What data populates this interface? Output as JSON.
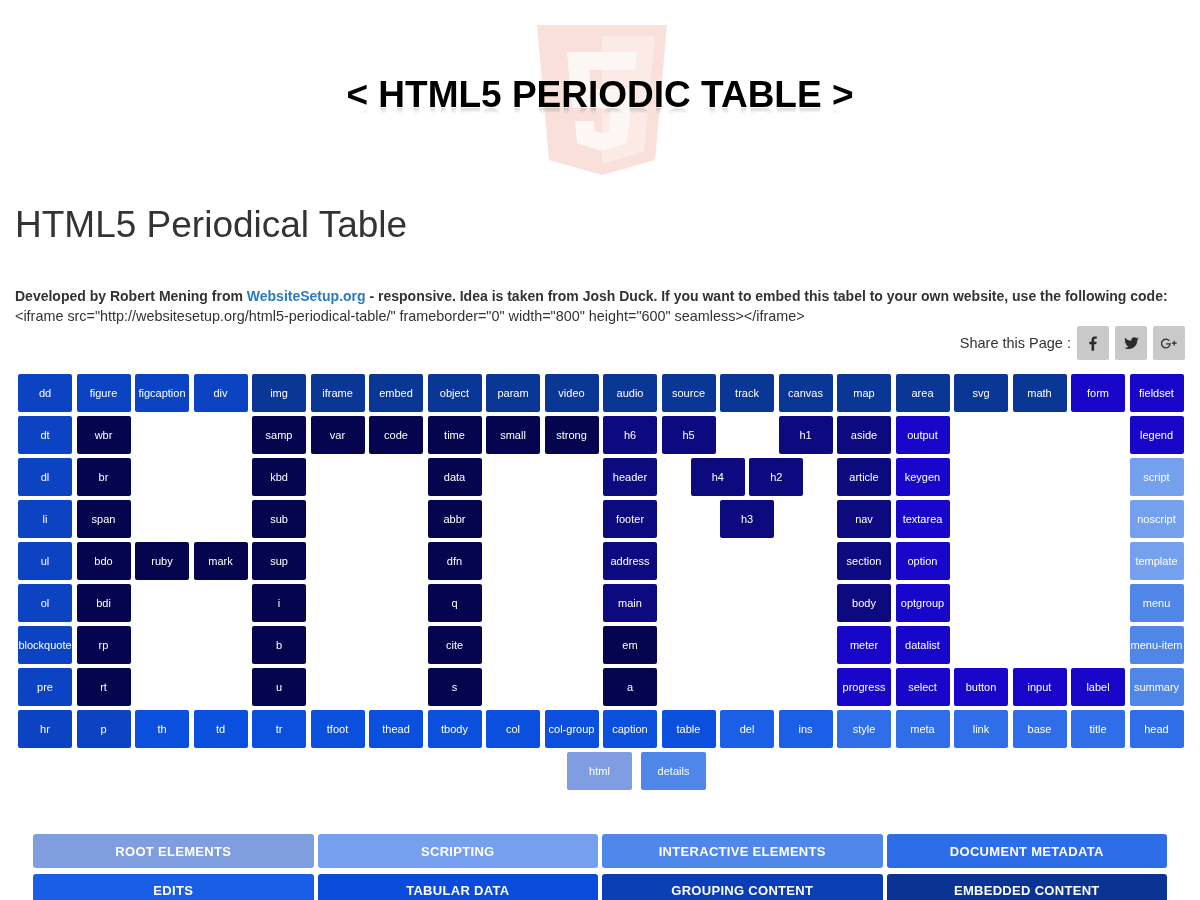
{
  "logo": {
    "text": "< HTML5 PERIODIC TABLE >"
  },
  "heading": "HTML5 Periodical Table",
  "intro": {
    "before": "Developed by Robert Mening from ",
    "link": "WebsiteSetup.org",
    "after": " - responsive. Idea is taken from Josh Duck. If you want to embed this tabel to your own website, use the following code:"
  },
  "embed_code": "<iframe src=\"http://websitesetup.org/html5-periodical-table/\" frameborder=\"0\" width=\"800\" height=\"600\" seamless></iframe>",
  "share": {
    "label": "Share this Page :",
    "buttons": [
      {
        "kind": "facebook"
      },
      {
        "kind": "twitter"
      },
      {
        "kind": "google_plus"
      }
    ]
  },
  "grid": {
    "rows": [
      [
        {
          "label": "dd",
          "color": "#0b43c2",
          "shifted": false
        },
        {
          "label": "figure",
          "color": "#0b43c2",
          "shifted": false
        },
        {
          "label": "figcaption",
          "color": "#0b43c2",
          "shifted": false
        },
        {
          "label": "div",
          "color": "#0b43c2",
          "shifted": false
        },
        {
          "label": "img",
          "color": "#0a3696",
          "shifted": false
        },
        {
          "label": "iframe",
          "color": "#0a3696",
          "shifted": false
        },
        {
          "label": "embed",
          "color": "#0a3696",
          "shifted": false
        },
        {
          "label": "object",
          "color": "#0a3696",
          "shifted": false
        },
        {
          "label": "param",
          "color": "#0a3696",
          "shifted": false
        },
        {
          "label": "video",
          "color": "#0a3696",
          "shifted": false
        },
        {
          "label": "audio",
          "color": "#0a3696",
          "shifted": false
        },
        {
          "label": "source",
          "color": "#0a3696",
          "shifted": false
        },
        {
          "label": "track",
          "color": "#0a3696",
          "shifted": false
        },
        {
          "label": "canvas",
          "color": "#0a3696",
          "shifted": false
        },
        {
          "label": "map",
          "color": "#0a3696",
          "shifted": false
        },
        {
          "label": "area",
          "color": "#0a3696",
          "shifted": false
        },
        {
          "label": "svg",
          "color": "#0a3696",
          "shifted": false
        },
        {
          "label": "math",
          "color": "#0a3696",
          "shifted": false
        },
        {
          "label": "form",
          "color": "#1706c9",
          "shifted": false
        },
        {
          "label": "fieldset",
          "color": "#1706c9",
          "shifted": false
        }
      ],
      [
        {
          "label": "dt",
          "color": "#0b43c2",
          "shifted": false
        },
        {
          "label": "wbr",
          "color": "#04044f",
          "shifted": false
        },
        null,
        null,
        {
          "label": "samp",
          "color": "#04044f",
          "shifted": false
        },
        {
          "label": "var",
          "color": "#04044f",
          "shifted": false
        },
        {
          "label": "code",
          "color": "#04044f",
          "shifted": false
        },
        {
          "label": "time",
          "color": "#04044f",
          "shifted": false
        },
        {
          "label": "small",
          "color": "#04044f",
          "shifted": false
        },
        {
          "label": "strong",
          "color": "#04044f",
          "shifted": false
        },
        {
          "label": "h6",
          "color": "#0d0a80",
          "shifted": false
        },
        {
          "label": "h5",
          "color": "#0d0a80",
          "shifted": false
        },
        null,
        {
          "label": "h1",
          "color": "#0d0a80",
          "shifted": false
        },
        {
          "label": "aside",
          "color": "#0d0a80",
          "shifted": false
        },
        {
          "label": "output",
          "color": "#1706c9",
          "shifted": false
        },
        null,
        null,
        null,
        {
          "label": "legend",
          "color": "#1706c9",
          "shifted": false
        }
      ],
      [
        {
          "label": "dl",
          "color": "#0b43c2",
          "shifted": false
        },
        {
          "label": "br",
          "color": "#04044f",
          "shifted": false
        },
        null,
        null,
        {
          "label": "kbd",
          "color": "#04044f",
          "shifted": false
        },
        null,
        null,
        {
          "label": "data",
          "color": "#04044f",
          "shifted": false
        },
        null,
        null,
        {
          "label": "header",
          "color": "#0d0a80",
          "shifted": false
        },
        null,
        {
          "label": "h4",
          "color": "#0d0a80",
          "shifted": true
        },
        {
          "label": "h2",
          "color": "#0d0a80",
          "shifted": true
        },
        {
          "label": "article",
          "color": "#0d0a80",
          "shifted": false
        },
        {
          "label": "keygen",
          "color": "#1706c9",
          "shifted": false
        },
        null,
        null,
        null,
        {
          "label": "script",
          "color": "#75a0ee",
          "shifted": false
        }
      ],
      [
        {
          "label": "li",
          "color": "#0b43c2",
          "shifted": false
        },
        {
          "label": "span",
          "color": "#04044f",
          "shifted": false
        },
        null,
        null,
        {
          "label": "sub",
          "color": "#04044f",
          "shifted": false
        },
        null,
        null,
        {
          "label": "abbr",
          "color": "#04044f",
          "shifted": false
        },
        null,
        null,
        {
          "label": "footer",
          "color": "#0d0a80",
          "shifted": false
        },
        null,
        {
          "label": "h3",
          "color": "#0d0a80",
          "shifted": false
        },
        null,
        {
          "label": "nav",
          "color": "#0d0a80",
          "shifted": false
        },
        {
          "label": "textarea",
          "color": "#1706c9",
          "shifted": false
        },
        null,
        null,
        null,
        {
          "label": "noscript",
          "color": "#75a0ee",
          "shifted": false
        }
      ],
      [
        {
          "label": "ul",
          "color": "#0b43c2",
          "shifted": false
        },
        {
          "label": "bdo",
          "color": "#04044f",
          "shifted": false
        },
        {
          "label": "ruby",
          "color": "#04044f",
          "shifted": false
        },
        {
          "label": "mark",
          "color": "#04044f",
          "shifted": false
        },
        {
          "label": "sup",
          "color": "#04044f",
          "shifted": false
        },
        null,
        null,
        {
          "label": "dfn",
          "color": "#04044f",
          "shifted": false
        },
        null,
        null,
        {
          "label": "address",
          "color": "#0d0a80",
          "shifted": false
        },
        null,
        null,
        null,
        {
          "label": "section",
          "color": "#0d0a80",
          "shifted": false
        },
        {
          "label": "option",
          "color": "#1706c9",
          "shifted": false
        },
        null,
        null,
        null,
        {
          "label": "template",
          "color": "#75a0ee",
          "shifted": false
        }
      ],
      [
        {
          "label": "ol",
          "color": "#0b43c2",
          "shifted": false
        },
        {
          "label": "bdi",
          "color": "#04044f",
          "shifted": false
        },
        null,
        null,
        {
          "label": "i",
          "color": "#04044f",
          "shifted": false
        },
        null,
        null,
        {
          "label": "q",
          "color": "#04044f",
          "shifted": false
        },
        null,
        null,
        {
          "label": "main",
          "color": "#0d0a80",
          "shifted": false
        },
        null,
        null,
        null,
        {
          "label": "body",
          "color": "#0d0a80",
          "shifted": false
        },
        {
          "label": "optgroup",
          "color": "#1706c9",
          "shifted": false
        },
        null,
        null,
        null,
        {
          "label": "menu",
          "color": "#4f86e8",
          "shifted": false
        }
      ],
      [
        {
          "label": "blockquote",
          "color": "#0b43c2",
          "shifted": false
        },
        {
          "label": "rp",
          "color": "#04044f",
          "shifted": false
        },
        null,
        null,
        {
          "label": "b",
          "color": "#04044f",
          "shifted": false
        },
        null,
        null,
        {
          "label": "cite",
          "color": "#04044f",
          "shifted": false
        },
        null,
        null,
        {
          "label": "em",
          "color": "#04044f",
          "shifted": false
        },
        null,
        null,
        null,
        {
          "label": "meter",
          "color": "#1706c9",
          "shifted": false
        },
        {
          "label": "datalist",
          "color": "#1706c9",
          "shifted": false
        },
        null,
        null,
        null,
        {
          "label": "menu-item",
          "color": "#4f86e8",
          "shifted": false
        }
      ],
      [
        {
          "label": "pre",
          "color": "#0b43c2",
          "shifted": false
        },
        {
          "label": "rt",
          "color": "#04044f",
          "shifted": false
        },
        null,
        null,
        {
          "label": "u",
          "color": "#04044f",
          "shifted": false
        },
        null,
        null,
        {
          "label": "s",
          "color": "#04044f",
          "shifted": false
        },
        null,
        null,
        {
          "label": "a",
          "color": "#04044f",
          "shifted": false
        },
        null,
        null,
        null,
        {
          "label": "progress",
          "color": "#1706c9",
          "shifted": false
        },
        {
          "label": "select",
          "color": "#1706c9",
          "shifted": false
        },
        {
          "label": "button",
          "color": "#1706c9",
          "shifted": false
        },
        {
          "label": "input",
          "color": "#1706c9",
          "shifted": false
        },
        {
          "label": "label",
          "color": "#1706c9",
          "shifted": false
        },
        {
          "label": "summary",
          "color": "#4f86e8",
          "shifted": false
        }
      ],
      [
        {
          "label": "hr",
          "color": "#0b43c2",
          "shifted": false
        },
        {
          "label": "p",
          "color": "#0b43c2",
          "shifted": false
        },
        {
          "label": "th",
          "color": "#0a4fde",
          "shifted": false
        },
        {
          "label": "td",
          "color": "#0a4fde",
          "shifted": false
        },
        {
          "label": "tr",
          "color": "#0a4fde",
          "shifted": false
        },
        {
          "label": "tfoot",
          "color": "#0a4fde",
          "shifted": false
        },
        {
          "label": "thead",
          "color": "#0a4fde",
          "shifted": false
        },
        {
          "label": "tbody",
          "color": "#0a4fde",
          "shifted": false
        },
        {
          "label": "col",
          "color": "#0a4fde",
          "shifted": false
        },
        {
          "label": "col-group",
          "color": "#0a4fde",
          "shifted": false
        },
        {
          "label": "caption",
          "color": "#0a4fde",
          "shifted": false
        },
        {
          "label": "table",
          "color": "#0a4fde",
          "shifted": false
        },
        {
          "label": "del",
          "color": "#1a5fe6",
          "shifted": false
        },
        {
          "label": "ins",
          "color": "#1a5fe6",
          "shifted": false
        },
        {
          "label": "style",
          "color": "#2f6ee8",
          "shifted": false
        },
        {
          "label": "meta",
          "color": "#2f6ee8",
          "shifted": false
        },
        {
          "label": "link",
          "color": "#2f6ee8",
          "shifted": false
        },
        {
          "label": "base",
          "color": "#2f6ee8",
          "shifted": false
        },
        {
          "label": "title",
          "color": "#2f6ee8",
          "shifted": false
        },
        {
          "label": "head",
          "color": "#2f6ee8",
          "shifted": false
        }
      ]
    ],
    "extra_row": [
      {
        "label": "html",
        "color": "#7f9de0"
      },
      {
        "label": "details",
        "color": "#4f86e8"
      }
    ]
  },
  "legend": [
    {
      "label": "ROOT ELEMENTS",
      "color": "#7f9ee0"
    },
    {
      "label": "SCRIPTING",
      "color": "#76a0ef"
    },
    {
      "label": "INTERACTIVE ELEMENTS",
      "color": "#4f87ea"
    },
    {
      "label": "DOCUMENT METADATA",
      "color": "#2e6de8"
    },
    {
      "label": "EDITS",
      "color": "#1a5ee6"
    },
    {
      "label": "TABULAR DATA",
      "color": "#0a4bdb"
    },
    {
      "label": "GROUPING CONTENT",
      "color": "#0a3db6"
    },
    {
      "label": "EMBEDDED CONTENT",
      "color": "#0a3394"
    }
  ]
}
